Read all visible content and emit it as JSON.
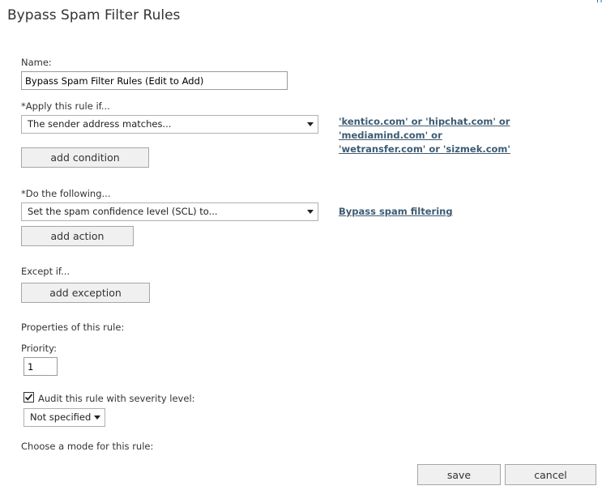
{
  "dialog": {
    "title": "Bypass Spam Filter Rules",
    "help_label": "H"
  },
  "name_field": {
    "label": "Name:",
    "value": "Bypass Spam Filter Rules (Edit to Add)"
  },
  "condition": {
    "label": "*Apply this rule if...",
    "selected": "The sender address matches...",
    "value_link_line1": "'kentico.com' or 'hipchat.com' or 'mediamind.com' or",
    "value_link_line2": "'wetransfer.com' or 'sizmek.com'",
    "add_button": "add condition"
  },
  "action": {
    "label": "*Do the following...",
    "selected": "Set the spam confidence level (SCL) to...",
    "value_link": "Bypass spam filtering",
    "add_button": "add action"
  },
  "exception": {
    "label": "Except if...",
    "add_button": "add exception"
  },
  "properties": {
    "heading": "Properties of this rule:",
    "priority_label": "Priority:",
    "priority_value": "1",
    "audit_checked": true,
    "audit_label": "Audit this rule with severity level:",
    "severity_selected": "Not specified",
    "mode_label": "Choose a mode for this rule:"
  },
  "footer": {
    "save_label": "save",
    "cancel_label": "cancel"
  }
}
